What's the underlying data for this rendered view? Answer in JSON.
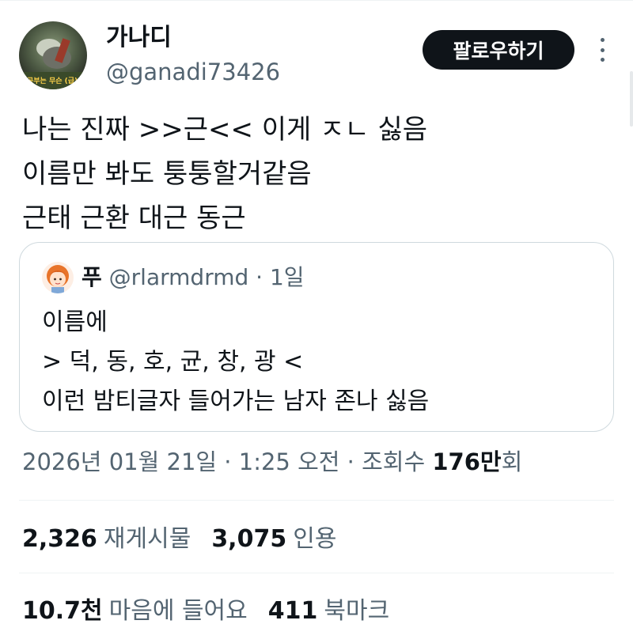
{
  "user": {
    "display_name": "가나디",
    "handle": "@ganadi73426",
    "avatar_caption": "공부는 무슨 (급)"
  },
  "actions": {
    "follow_label": "팔로우하기",
    "more_icon": "more-vertical-icon"
  },
  "tweet": {
    "lines": [
      "나는 진짜 >>근<< 이게 ㅈㄴ 싫음",
      "이름만 봐도 퉁퉁할거같음",
      "근태 근환 대근 동근"
    ]
  },
  "quote": {
    "name": "푸",
    "handle": "@rlarmdrmd",
    "separator": "·",
    "time": "1일",
    "lines": [
      "이름에",
      "> 덕, 동, 호, 균, 창, 광 <",
      "이런 밤티글자 들어가는 남자 존나 싫음"
    ]
  },
  "meta": {
    "datetime": "2026년 01월 21일 · 1:25 오전 · 조회수 ",
    "views_number": "176만",
    "views_suffix": "회"
  },
  "stats": {
    "reposts_count": "2,326",
    "reposts_label": "재게시물",
    "quotes_count": "3,075",
    "quotes_label": "인용",
    "likes_count": "10.7천",
    "likes_label": "마음에 들어요",
    "bookmarks_count": "411",
    "bookmarks_label": "북마크"
  },
  "colors": {
    "text_primary": "#0f1419",
    "text_secondary": "#536471",
    "border": "#cfd9de",
    "divider": "#eff3f4",
    "button_bg": "#0f1419"
  }
}
